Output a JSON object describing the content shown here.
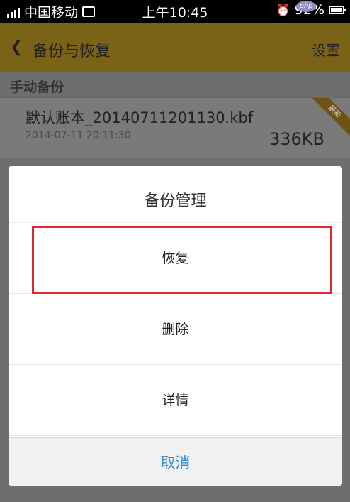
{
  "status_bar": {
    "carrier": "中国移动",
    "time": "上午10:45",
    "battery_text": "92%",
    "watermark": "php",
    "icons": [
      "signal-icon",
      "image-icon",
      "alarm-icon",
      "battery-icon"
    ]
  },
  "header": {
    "back_icon": "chevron-left-icon",
    "title": "备份与恢复",
    "settings_label": "设置"
  },
  "section": {
    "title": "手动备份"
  },
  "backup_file": {
    "name": "默认账本_20140711201130.kbf",
    "timestamp": "2014-07-11 20:11:30",
    "size": "336KB",
    "badge": "最新"
  },
  "dialog": {
    "title": "备份管理",
    "options": [
      "恢复",
      "删除",
      "详情"
    ],
    "cancel_label": "取消"
  },
  "colors": {
    "header_yellow": "#f4c430",
    "cancel_blue": "#2e8dd9",
    "highlight_red": "#e0282c"
  }
}
